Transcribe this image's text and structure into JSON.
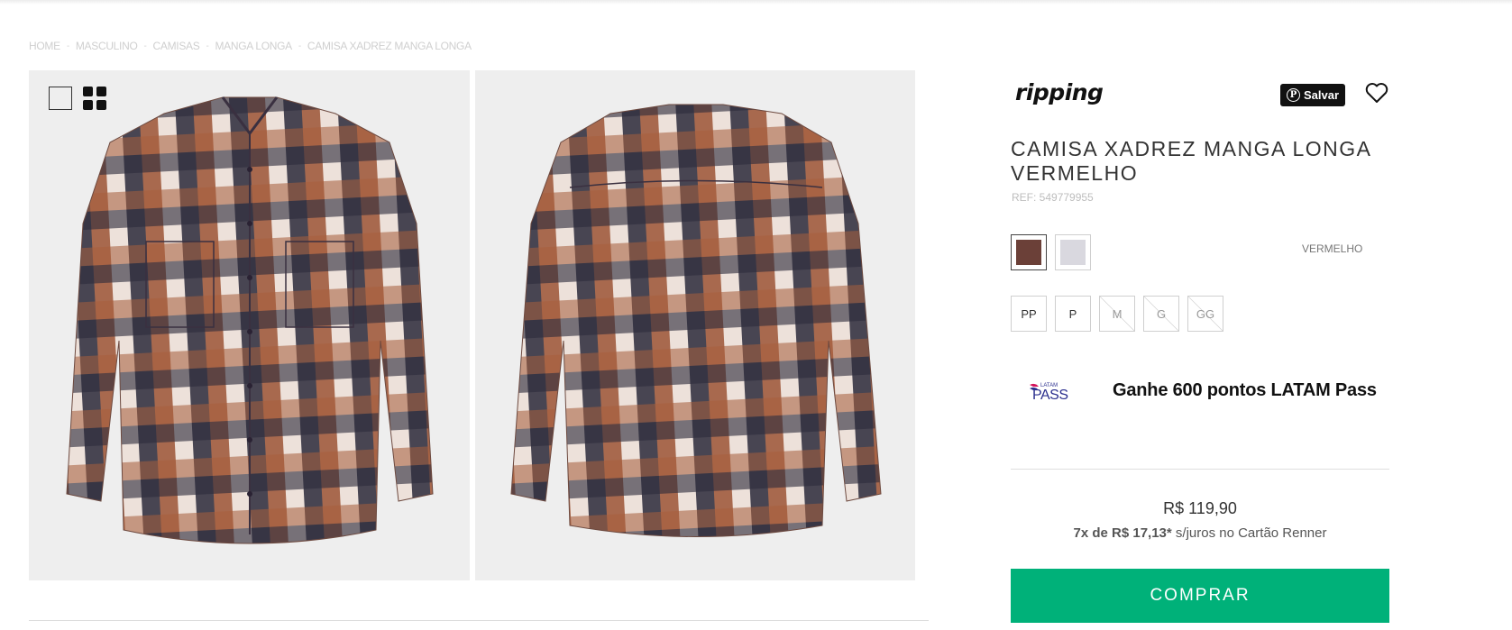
{
  "breadcrumb": [
    "HOME",
    "MASCULINO",
    "CAMISAS",
    "MANGA LONGA",
    "CAMISA XADREZ MANGA LONGA"
  ],
  "breadcrumb_separator": "-",
  "brand": "ripping",
  "pinterest": {
    "label": "Salvar",
    "icon": "pinterest-icon"
  },
  "product": {
    "title": "CAMISA XADREZ MANGA LONGA VERMELHO",
    "ref": "REF: 549779955",
    "color_name": "VERMELHO",
    "colors": [
      {
        "hex": "#6b4038",
        "selected": true
      },
      {
        "hex": "#d9d8df",
        "selected": false
      }
    ],
    "sizes": [
      {
        "label": "PP",
        "available": true
      },
      {
        "label": "P",
        "available": true
      },
      {
        "label": "M",
        "available": false
      },
      {
        "label": "G",
        "available": false
      },
      {
        "label": "GG",
        "available": false
      }
    ]
  },
  "loyalty": {
    "logo_text": "PASS",
    "logo_small": "LATAM",
    "text": "Ganhe 600 pontos LATAM Pass"
  },
  "price": {
    "value": "R$ 119,90",
    "installments_bold": "7x de R$ 17,13*",
    "installments_rest": " s/juros no Cartão Renner"
  },
  "buy_label": "COMPRAR",
  "colors": {
    "buy": "#00b179",
    "plaid_rust": "#9c5536",
    "plaid_navy": "#2b2a3b",
    "plaid_cream": "#ecdfd6"
  }
}
